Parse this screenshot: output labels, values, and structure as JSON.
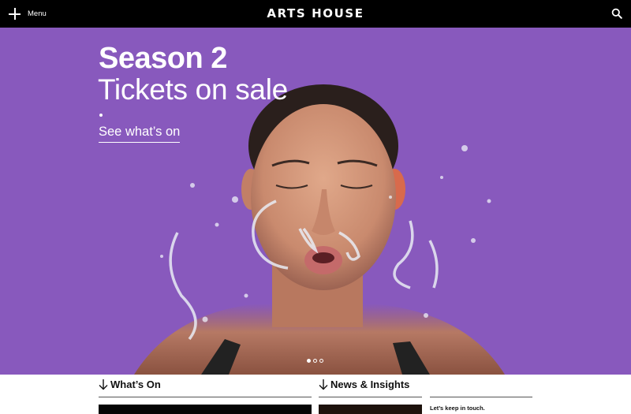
{
  "header": {
    "menu_label": "Menu",
    "logo_text": "ARTS HOUSE",
    "menu_icon": "plus-icon",
    "search_icon": "search-icon"
  },
  "hero": {
    "title": "Season 2",
    "subtitle": "Tickets on sale",
    "cta": "See what’s on",
    "background_color": "#8859bd",
    "carousel_total": 3,
    "carousel_active": 1
  },
  "sections": {
    "whats_on": "What’s On",
    "news": "News & Insights",
    "newsletter": "Let’s keep in touch."
  }
}
